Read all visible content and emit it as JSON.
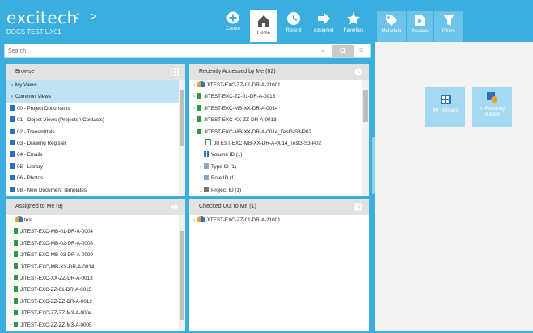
{
  "header": {
    "logo": "excitech",
    "nav_back": "<",
    "nav_forward": ">",
    "database": "DOCS TEST UX01",
    "toolbar": [
      {
        "id": "create",
        "label": "Create"
      },
      {
        "id": "home",
        "label": "Home"
      },
      {
        "id": "recent",
        "label": "Recent"
      },
      {
        "id": "assigned",
        "label": "Assigned"
      },
      {
        "id": "favorites",
        "label": "Favorites"
      }
    ],
    "panel_toolbar": [
      {
        "id": "metadata",
        "label": "Metadata"
      },
      {
        "id": "preview",
        "label": "Preview"
      },
      {
        "id": "filters",
        "label": "Filters"
      }
    ]
  },
  "search": {
    "placeholder": "Search",
    "value": "Search"
  },
  "browse": {
    "title": "Browse",
    "items": [
      {
        "label": "My Views",
        "kind": "section"
      },
      {
        "label": "Common Views",
        "kind": "section"
      },
      {
        "label": "00 - Project Documents",
        "kind": "view"
      },
      {
        "label": "01 - Object Views (Projects \\ Contacts)",
        "kind": "view"
      },
      {
        "label": "02 - Transmittals",
        "kind": "view"
      },
      {
        "label": "03 - Drawing Register",
        "kind": "view"
      },
      {
        "label": "04 - Emails",
        "kind": "view"
      },
      {
        "label": "05 - Library",
        "kind": "view"
      },
      {
        "label": "06 - Photos",
        "kind": "view"
      },
      {
        "label": "98 - New Document Templates",
        "kind": "view"
      }
    ]
  },
  "recent": {
    "title": "Recently Accessed by Me (62)",
    "items": [
      {
        "label": "JITEST-EXC-ZZ-01-DR-A-21001",
        "icon": "people-icon"
      },
      {
        "label": "JITEST-EXC-ZZ-01-DR-A-0015",
        "icon": "doc-icon"
      },
      {
        "label": "JITEST-EXC-MB-XX-DR-A-0014",
        "icon": "doc-icon"
      },
      {
        "label": "JITEST-EXC-XX-ZZ-DR-A-0013",
        "icon": "doc-icon"
      },
      {
        "label": "JITEST-EXC-MB-XX-DR-A-0014_Test3-S3-P02",
        "icon": "doc-icon"
      },
      {
        "label": "JITEST-EXC-MB-XX-DR-A-0014_Test3-S3-P02",
        "icon": "file-icon"
      },
      {
        "label": "Volume ID (1)",
        "icon": "grid-icon"
      },
      {
        "label": "Type ID (1)",
        "icon": "doc-icon"
      },
      {
        "label": "Role ID (1)",
        "icon": "doc-icon"
      },
      {
        "label": "Project ID (1)",
        "icon": "folder-icon"
      }
    ]
  },
  "assigned": {
    "title": "Assigned to Me (9)",
    "items": [
      {
        "label": "test",
        "icon": "people-icon"
      },
      {
        "label": "JITEST-EXC-MB-01-DR-A-0004",
        "icon": "doc-icon"
      },
      {
        "label": "JITEST-EXC-MB-02-DR-A-0008",
        "icon": "doc-icon"
      },
      {
        "label": "JITEST-EXC-MB-03-DR-A-0009",
        "icon": "doc-icon"
      },
      {
        "label": "JITEST-EXC-MB-XX-DR-A-0014",
        "icon": "doc-icon"
      },
      {
        "label": "JITEST-EXC-XX-ZZ-DR-A-0013",
        "icon": "doc-icon"
      },
      {
        "label": "JITEST-EXC-ZZ-01-DR-A-0015",
        "icon": "doc-icon"
      },
      {
        "label": "JITEST-EXC-ZZ-ZZ-DR-A-0012",
        "icon": "doc-icon"
      },
      {
        "label": "JITEST-EXC-ZZ-ZZ-M3-A-0004",
        "icon": "doc-icon"
      },
      {
        "label": "JITEST-EXC-ZZ-ZZ-M3-A-0005",
        "icon": "doc-icon"
      }
    ]
  },
  "checked_out": {
    "title": "Checked Out to Me (1)",
    "items": [
      {
        "label": "JITEST-EXC-ZZ-01-DR-A-21001",
        "icon": "people-icon"
      }
    ]
  },
  "tiles": [
    {
      "label": "04 - Emails",
      "icon": "grid-icon"
    },
    {
      "label": "4. Recently Added",
      "icon": "recent-icon"
    }
  ],
  "colors": {
    "accent": "#3aaedf",
    "doc_green": "#2e9a3e",
    "view_blue": "#2d6fc2",
    "tile": "#a5d9f1"
  }
}
